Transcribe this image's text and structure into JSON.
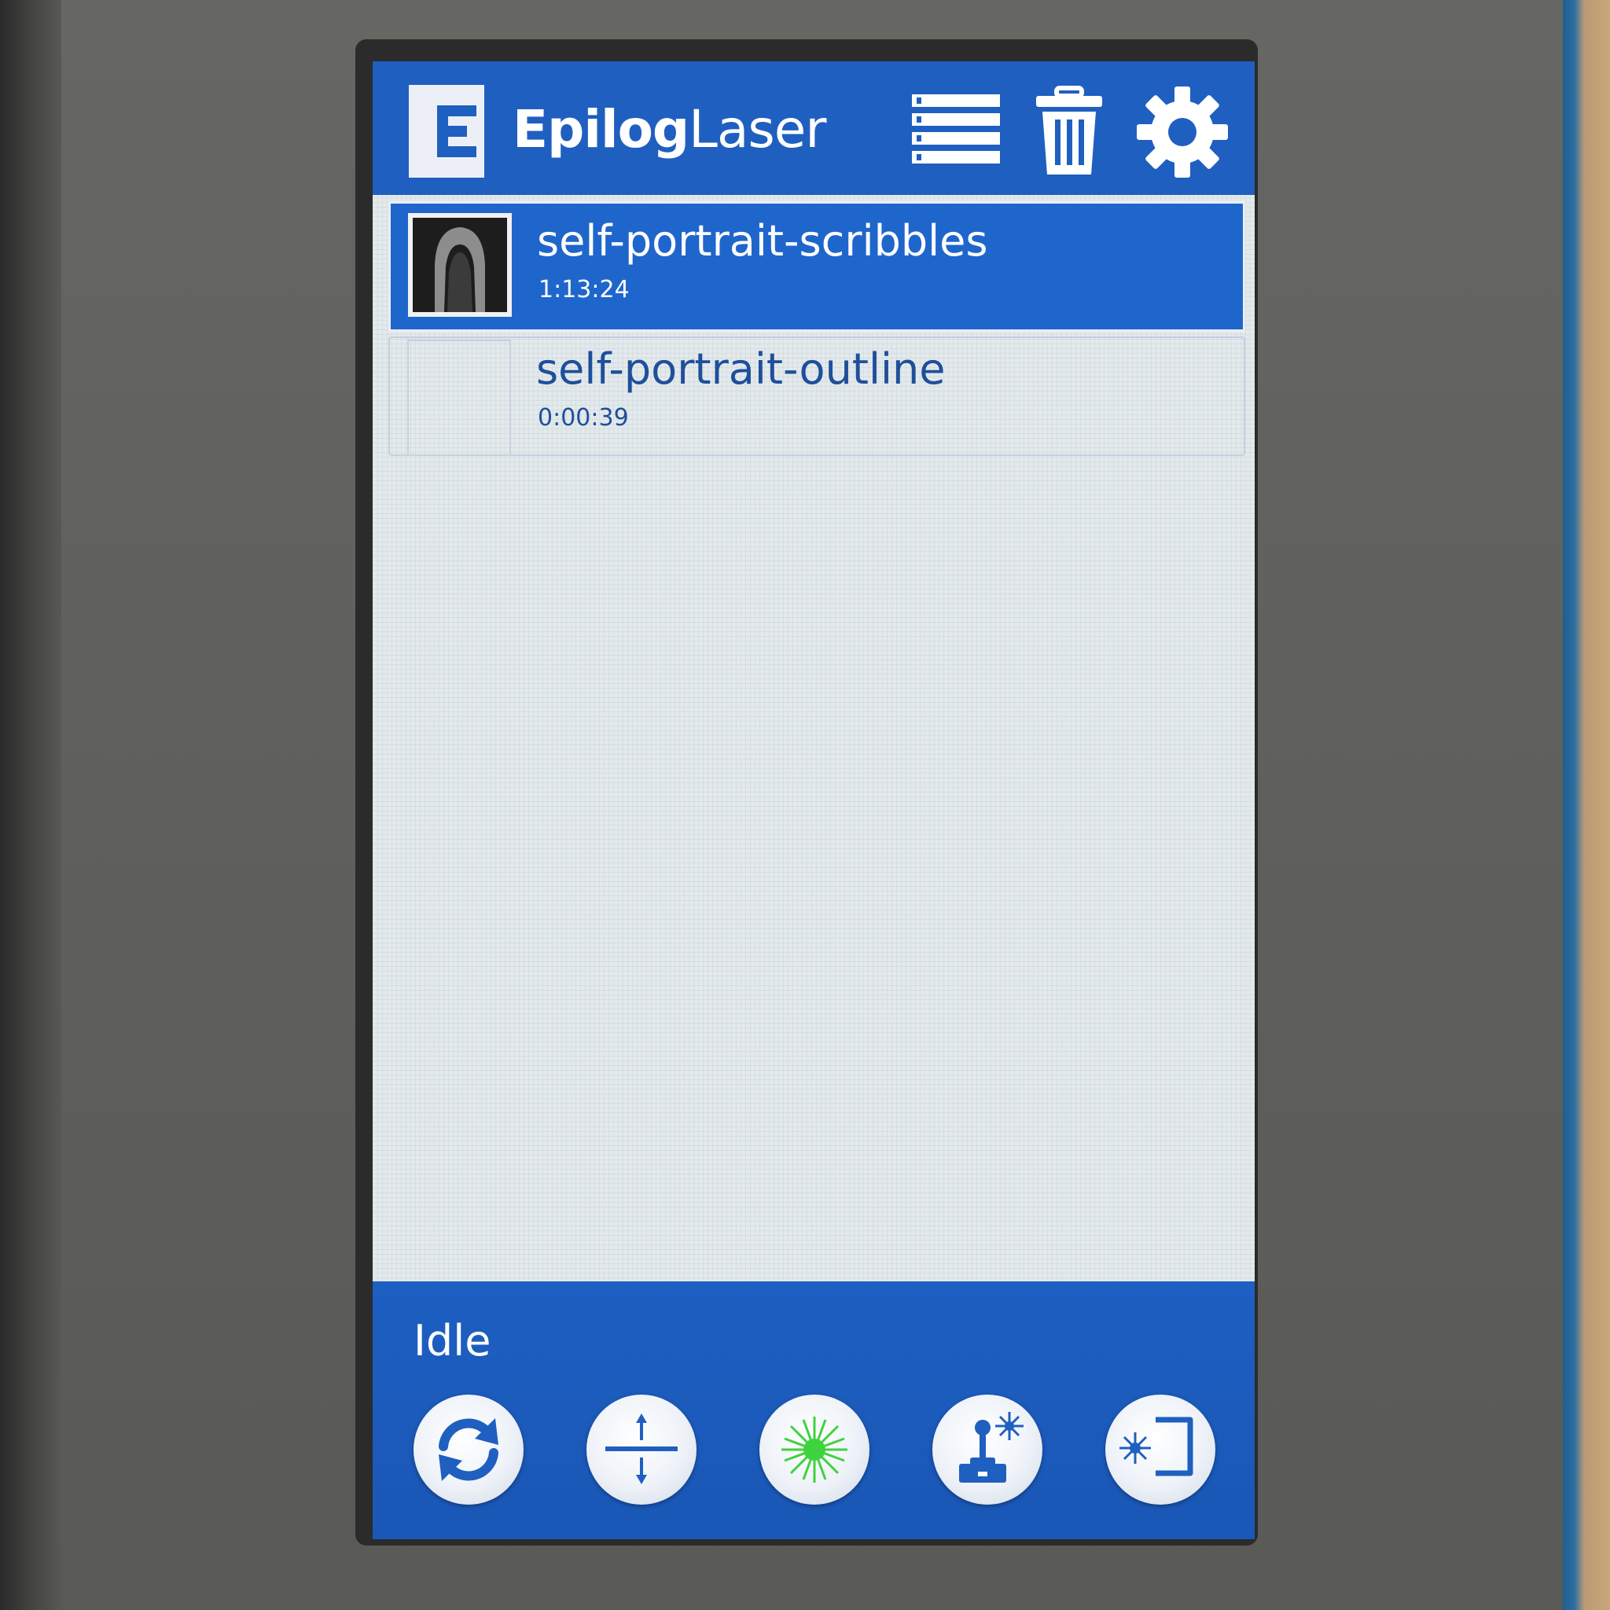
{
  "header": {
    "brand_bold": "Epilog",
    "brand_light": "Laser",
    "icons": [
      "logo-e-icon",
      "job-list-icon",
      "trash-icon",
      "gear-icon"
    ]
  },
  "jobs": [
    {
      "title": "self-portrait-scribbles",
      "time": "1:13:24",
      "selected": true
    },
    {
      "title": "self-portrait-outline",
      "time": "0:00:39",
      "selected": false
    }
  ],
  "footer": {
    "status": "Idle",
    "controls": [
      "refresh-icon",
      "focus-icon",
      "red-dot-pointer-icon",
      "joystick-icon",
      "frame-icon"
    ]
  },
  "colors": {
    "header_blue": "#1f5fc0",
    "selected_row": "#1f66cc",
    "list_bg": "#e4e9ec",
    "pointer_green": "#3fd23f"
  }
}
